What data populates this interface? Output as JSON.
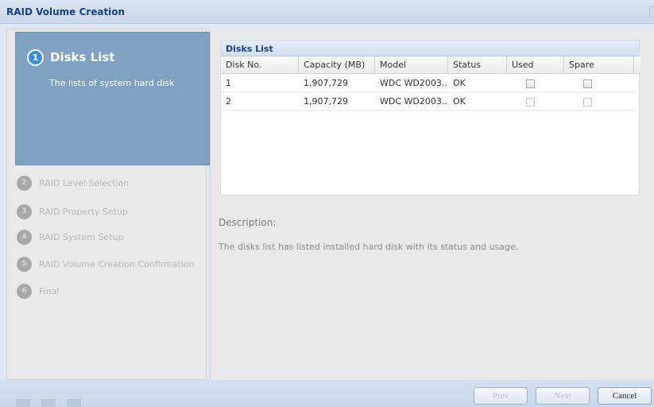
{
  "window": {
    "title": "RAID Volume Creation"
  },
  "wizard": {
    "active_step": {
      "number": "1",
      "title": "Disks List",
      "description": "The lists of system hard disk"
    },
    "steps": [
      {
        "number": "2",
        "label": "RAID Level Selection"
      },
      {
        "number": "3",
        "label": "RAID Property Setup"
      },
      {
        "number": "4",
        "label": "RAID System Setup"
      },
      {
        "number": "5",
        "label": "RAID Volume Creation Confirmation"
      },
      {
        "number": "6",
        "label": "Final"
      }
    ]
  },
  "disks_grid": {
    "title": "Disks List",
    "columns": [
      "Disk No.",
      "Capacity (MB)",
      "Model",
      "Status",
      "Used",
      "Spare"
    ],
    "rows": [
      {
        "disk_no": "1",
        "capacity": "1,907,729",
        "model": "WDC WD2003...",
        "status": "OK",
        "used": false,
        "spare": false
      },
      {
        "disk_no": "2",
        "capacity": "1,907,729",
        "model": "WDC WD2003...",
        "status": "OK",
        "used": false,
        "spare": false
      }
    ]
  },
  "description": {
    "title": "Description:",
    "text": "The disks list has listed installed hard disk with its status and usage."
  },
  "footer": {
    "prev_label": "Prev",
    "next_label": "Next",
    "cancel_label": "Cancel"
  },
  "colors": {
    "accent": "#7fa2c2",
    "title_text": "#15428b"
  }
}
